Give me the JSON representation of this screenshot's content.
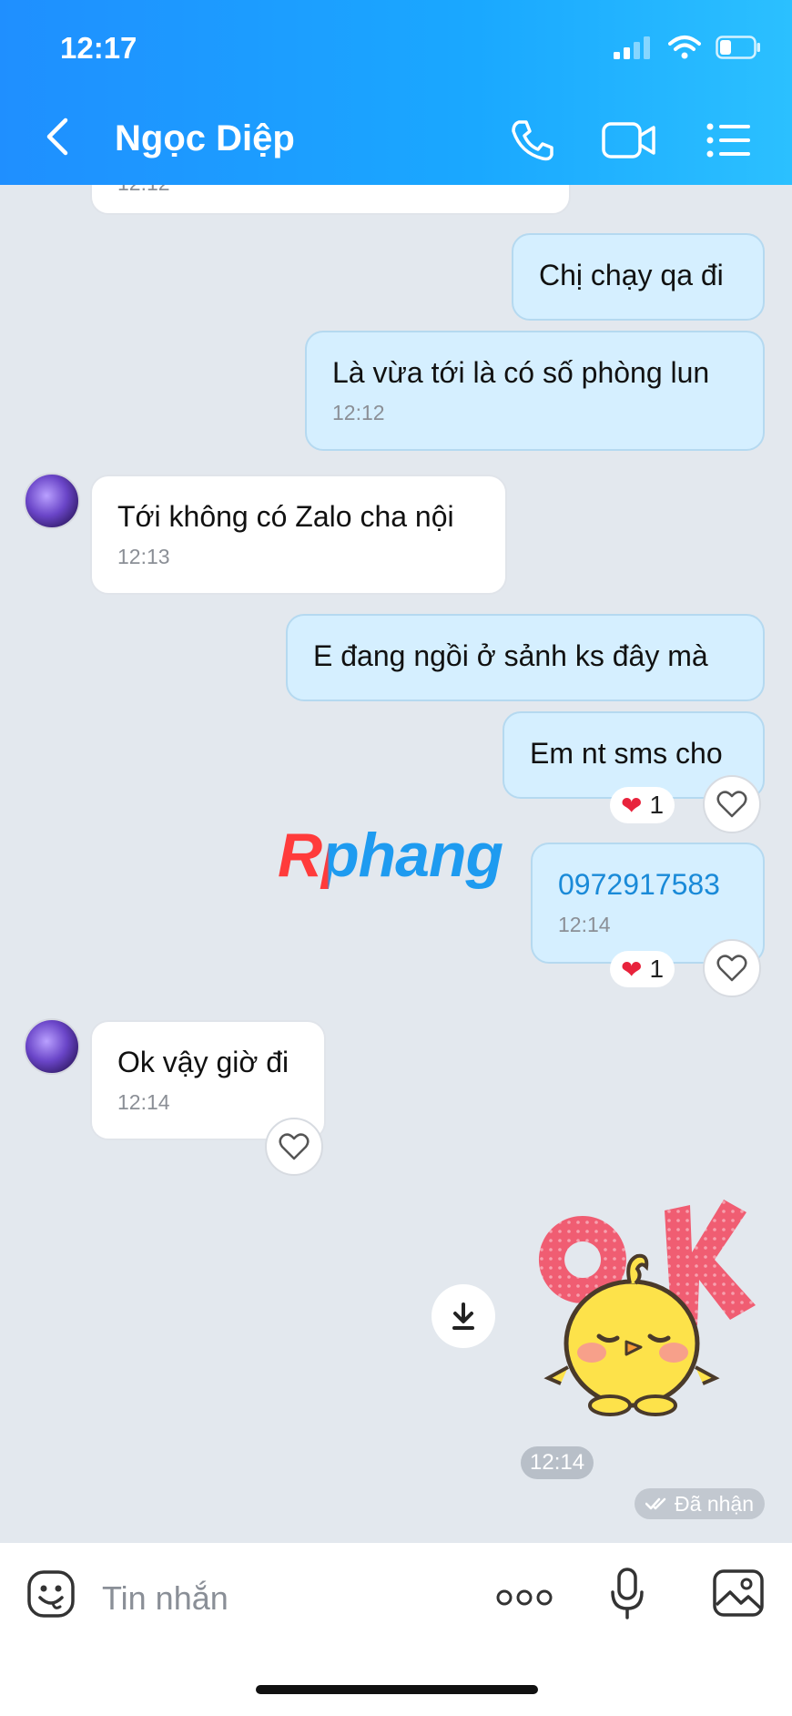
{
  "status_bar": {
    "time": "12:17"
  },
  "header": {
    "title": "Ngọc Diệp",
    "back_icon": "chevron-left-icon",
    "call_icon": "phone-icon",
    "video_icon": "video-camera-icon",
    "menu_icon": "list-menu-icon"
  },
  "messages": [
    {
      "from": "them",
      "text": "",
      "time": "12:12"
    },
    {
      "from": "me",
      "text": "Chị chạy qa đi"
    },
    {
      "from": "me",
      "text": "Là vừa tới là có số phòng lun",
      "time": "12:12"
    },
    {
      "from": "them",
      "text": "Tới không có Zalo cha nội",
      "time": "12:13"
    },
    {
      "from": "me",
      "text": "E đang ngồi ở sảnh ks đây mà"
    },
    {
      "from": "me",
      "text": "Em nt sms cho",
      "reaction": "❤",
      "reaction_count": "1"
    },
    {
      "from": "me",
      "text": "0972917583",
      "time": "12:14",
      "reaction": "❤",
      "reaction_count": "1",
      "link_color": "#1a8ad8"
    },
    {
      "from": "them",
      "text": "Ok vậy giờ đi",
      "time": "12:14"
    },
    {
      "from": "me",
      "sticker": "OK",
      "time": "12:14",
      "status": "Đã nhận"
    }
  ],
  "watermark": "Rphang",
  "input": {
    "placeholder": "Tin nhắn",
    "emoji_icon": "emoji-icon",
    "more_icon": "more-dots-icon",
    "mic_icon": "microphone-icon",
    "image_icon": "image-icon"
  },
  "colors": {
    "header": "#1f8fff",
    "bubble_me": "#d5efff",
    "bubble_them": "#ffffff",
    "background": "#e3e8ee",
    "heart": "#e8233c"
  }
}
